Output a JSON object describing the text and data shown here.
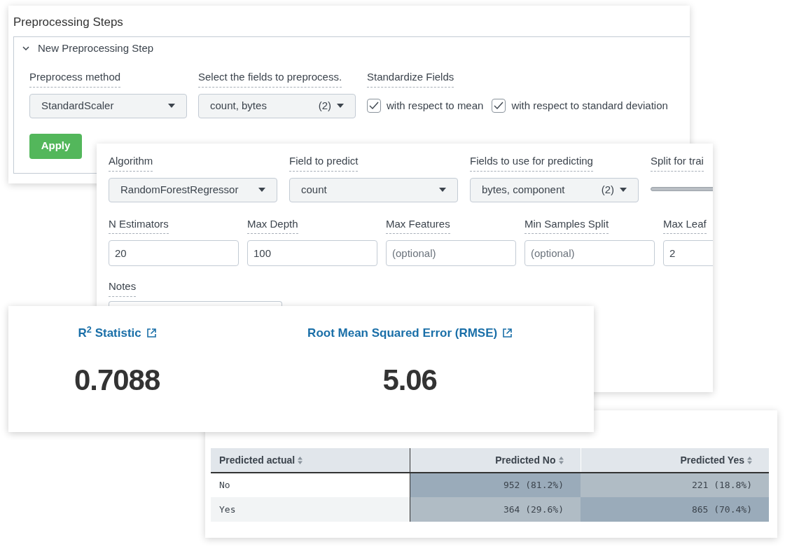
{
  "preprocessing": {
    "title": "Preprocessing Steps",
    "step": {
      "title": "New Preprocessing Step",
      "expanded": true,
      "method": {
        "label": "Preprocess method",
        "value": "StandardScaler"
      },
      "fields": {
        "label": "Select the fields to preprocess.",
        "value": "count, bytes",
        "count": "(2)"
      },
      "standardize": {
        "label": "Standardize Fields",
        "options": [
          {
            "label": "with respect to mean",
            "checked": true
          },
          {
            "label": "with respect to standard deviation",
            "checked": true
          }
        ]
      },
      "button": "Apply"
    }
  },
  "model": {
    "selects": [
      {
        "label": "Algorithm",
        "value": "RandomForestRegressor"
      },
      {
        "label": "Field to predict",
        "value": "count"
      },
      {
        "label": "Fields to use for predicting",
        "value": "bytes, component",
        "count": "(2)"
      }
    ],
    "split_label": "Split for trai",
    "params": [
      {
        "label": "N Estimators",
        "value": "20"
      },
      {
        "label": "Max Depth",
        "value": "100"
      },
      {
        "label": "Max Features",
        "placeholder": "(optional)"
      },
      {
        "label": "Min Samples Split",
        "placeholder": "(optional)"
      },
      {
        "label": "Max Leaf",
        "value": "2"
      }
    ],
    "notes_label": "Notes"
  },
  "metrics": [
    {
      "title": "R$^{2}$ Statistic",
      "value": "0.7088"
    },
    {
      "title": "Root Mean Squared Error (RMSE)",
      "value": "5.06"
    }
  ],
  "confusion_matrix": {
    "columns": [
      "Predicted actual",
      "Predicted No",
      "Predicted Yes"
    ],
    "rows": [
      {
        "cells": [
          {
            "text": "No"
          },
          {
            "text": "952 (81.2%)",
            "color": "#9aabba"
          },
          {
            "text": "221 (18.8%)",
            "color": "#b0bcc5"
          }
        ]
      },
      {
        "cells": [
          {
            "text": "Yes"
          },
          {
            "text": "364 (29.6%)",
            "color": "#b0bcc5"
          },
          {
            "text": "865 (70.4%)",
            "color": "#9aabba"
          }
        ]
      }
    ]
  }
}
